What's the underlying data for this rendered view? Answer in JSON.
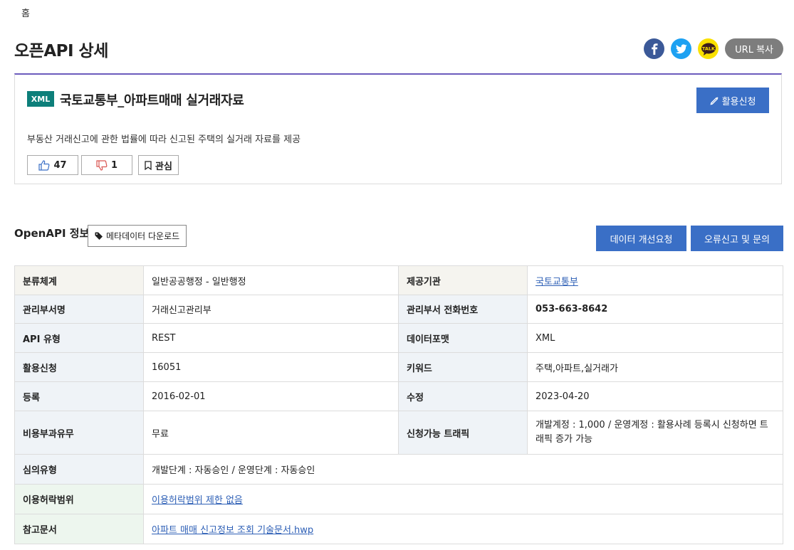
{
  "breadcrumb": "홈",
  "page_title": "오픈API 상세",
  "share": {
    "url_copy_label": "URL 복사",
    "kakao_text": "TALK"
  },
  "summary": {
    "format_badge": "XML",
    "api_name": "국토교통부_아파트매매 실거래자료",
    "apply_label": "활용신청",
    "description": "부동산 거래신고에 관한 법률에 따라 신고된 주택의 실거래 자료를 제공",
    "likes": "47",
    "dislikes": "1",
    "favorite_label": "관심"
  },
  "openapi": {
    "section_title": "OpenAPI 정보",
    "metadata_download_label": "메타데이터 다운로드",
    "improve_request_label": "데이터 개선요청",
    "error_report_label": "오류신고 및 문의"
  },
  "info_table": [
    {
      "label1": "분류체계",
      "value1": "일반공공행정 - 일반행정",
      "label2": "제공기관",
      "value2": "국토교통부"
    },
    {
      "label1": "관리부서명",
      "value1": "거래신고관리부",
      "label2": "관리부서 전화번호",
      "value2": "053-663-8642"
    },
    {
      "label1": "API 유형",
      "value1": "REST",
      "label2": "데이터포맷",
      "value2": "XML"
    },
    {
      "label1": "활용신청",
      "value1": "16051",
      "label2": "키워드",
      "value2": "주택,아파트,실거래가"
    },
    {
      "label1": "등록",
      "value1": "2016-02-01",
      "label2": "수정",
      "value2": "2023-04-20"
    },
    {
      "label1": "비용부과유무",
      "value1": "무료",
      "label2": "신청가능 트래픽",
      "value2": "개발계정 : 1,000 / 운영계정 : 활용사례 등록시 신청하면 트래픽 증가 가능"
    },
    {
      "label": "심의유형",
      "value": "개발단계 : 자동승인 / 운영단계 : 자동승인"
    },
    {
      "label": "이용허락범위",
      "value": "이용허락범위 제한 없음"
    },
    {
      "label": "참고문서",
      "value": "아파트 매매 신고정보 조회 기술문서.hwp"
    }
  ],
  "colors": {
    "accent_blue": "#3a6fc6",
    "badge_teal": "#0d7f7a",
    "top_border_purple": "#6b5bbd",
    "link_blue": "#2d5fb6"
  }
}
